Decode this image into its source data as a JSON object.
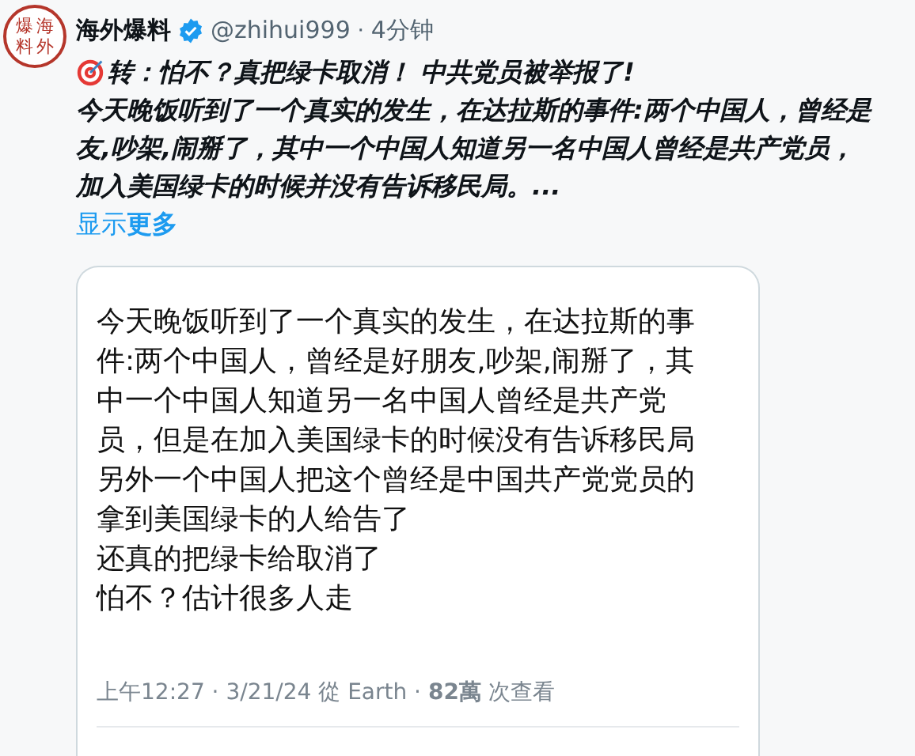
{
  "post": {
    "avatar_glyphs": [
      "爆",
      "海",
      "料",
      "外"
    ],
    "author": "海外爆料",
    "handle": "@zhihui999",
    "separator": "·",
    "time": "4分钟",
    "verified": true,
    "headline": "转：怕不？真把绿卡取消！ 中共党员被举报了!",
    "body_lines": [
      "今天晚饭听到了一个真实的发生，在达拉斯的事件:两个中国人，曾经是",
      "友,吵架,闹掰了，其中一个中国人知道另一名中国人曾经是共产党员，",
      "加入美国绿卡的时候并没有告诉移民局。..."
    ],
    "show_more": "显示**更多**"
  },
  "quoted_screenshot": {
    "lines": [
      "今天晚饭听到了一个真实的发生，在达拉斯的事",
      "件:两个中国人，曾经是好朋友,吵架,闹掰了，其",
      "中一个中国人知道另一名中国人曾经是共产党",
      "员，但是在加入美国绿卡的时候没有告诉移民局",
      "另外一个中国人把这个曾经是中国共产党党员的",
      "拿到美国绿卡的人给告了",
      "还真的把绿卡给取消了",
      "怕不？估计很多人走"
    ],
    "footer": "上午12:27 · 3/21/24 從 Earth · **82萬** 次查看"
  }
}
